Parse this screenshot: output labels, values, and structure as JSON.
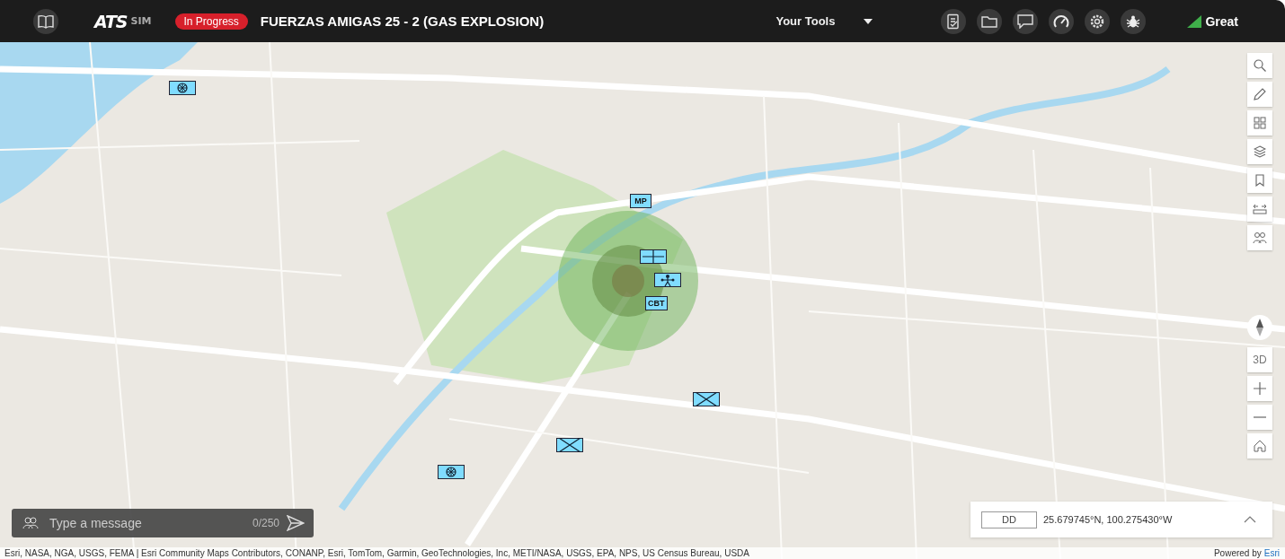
{
  "header": {
    "logo": "ATS",
    "logo_suffix": "SIM",
    "status": "In Progress",
    "title": "FUERZAS AMIGAS 25 - 2 (GAS EXPLOSION)",
    "tools_menu": "Your Tools",
    "connection": "Great"
  },
  "markers": [
    {
      "kind": "medical"
    },
    {
      "kind": "label",
      "text": "MP"
    },
    {
      "kind": "grid"
    },
    {
      "kind": "figure"
    },
    {
      "kind": "label",
      "text": "CBT"
    },
    {
      "kind": "cross"
    },
    {
      "kind": "cross"
    },
    {
      "kind": "medical"
    }
  ],
  "map_controls": {
    "view_toggle": "3D"
  },
  "chat": {
    "placeholder": "Type a message",
    "counter": "0/250"
  },
  "coordinates": {
    "format": "DD",
    "value": "25.679745°N, 100.275430°W"
  },
  "attribution": {
    "sources": "Esri, NASA, NGA, USGS, FEMA | Esri Community Maps Contributors, CONANP, Esri, TomTom, Garmin, GeoTechnologies, Inc, METI/NASA, USGS, EPA, NPS, US Census Bureau, USDA",
    "powered_by": "Powered by",
    "link": "Esri"
  }
}
